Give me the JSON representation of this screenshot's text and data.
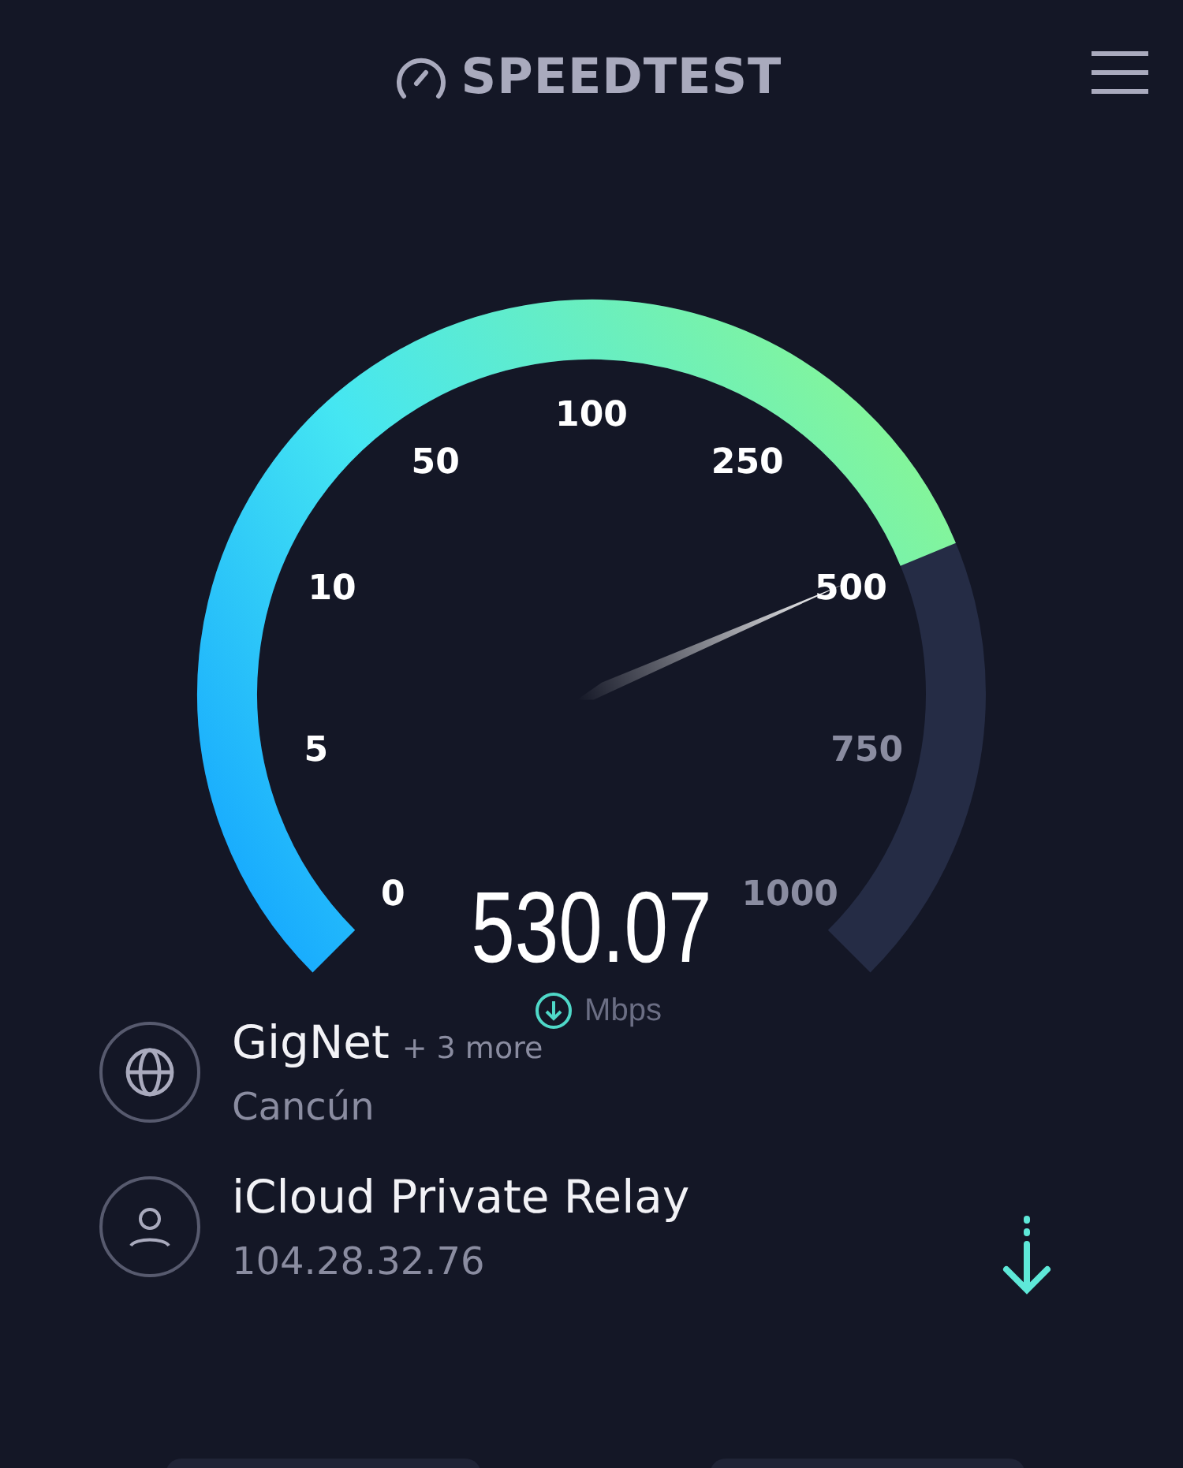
{
  "header": {
    "logo": "SPEEDTEST"
  },
  "gauge": {
    "ticks": [
      "0",
      "5",
      "10",
      "50",
      "100",
      "250",
      "500",
      "750",
      "1000"
    ],
    "reading": "530.07",
    "unit": "Mbps"
  },
  "connections": [
    {
      "kind": "network",
      "title": "GigNet",
      "extra": "+ 3 more",
      "subtitle": "Cancún"
    },
    {
      "kind": "relay",
      "title": "iCloud Private Relay",
      "subtitle": "104.28.32.76"
    }
  ]
}
